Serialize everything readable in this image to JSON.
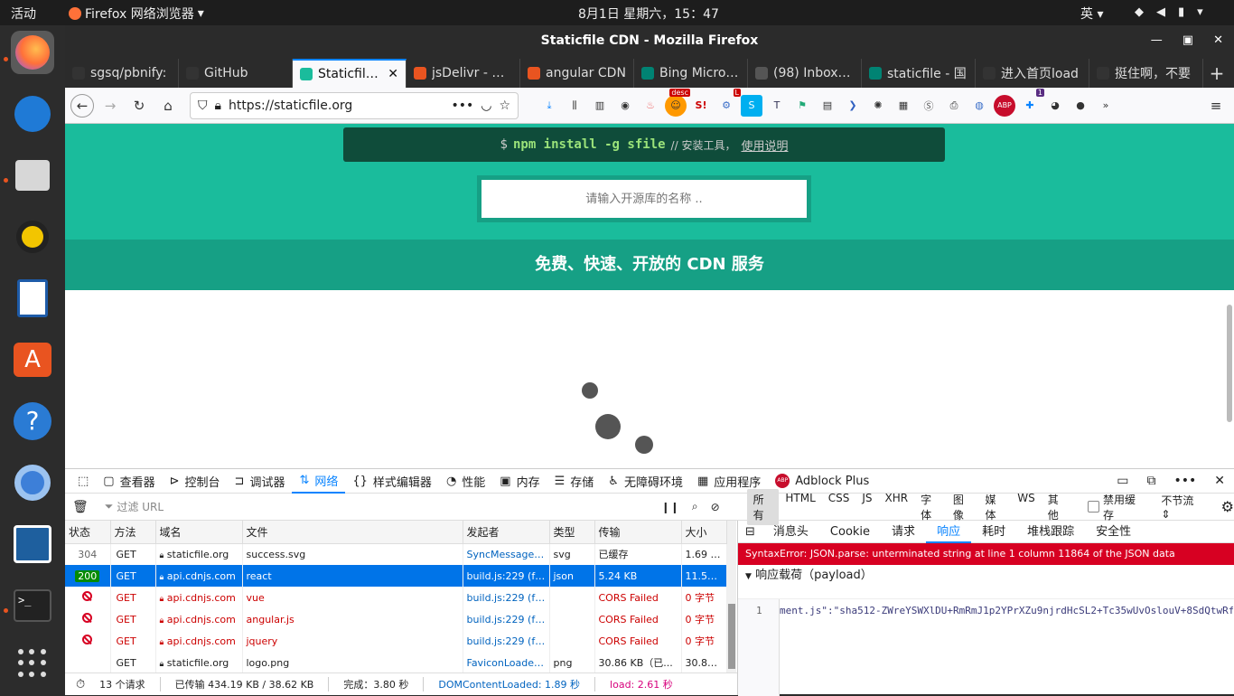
{
  "system": {
    "activities": "活动",
    "app_name": "Firefox 网络浏览器",
    "clock": "8月1日 星期六，15：47",
    "ime": "英"
  },
  "window": {
    "title": "Staticfile CDN - Mozilla Firefox"
  },
  "tabs": [
    {
      "label": "sgsq/pbnify:",
      "color": "#333"
    },
    {
      "label": "GitHub",
      "color": "#333"
    },
    {
      "label": "Staticfile CDN",
      "color": "#1abc9c",
      "active": true
    },
    {
      "label": "jsDelivr - A fr",
      "color": "#e95420"
    },
    {
      "label": "angular CDN",
      "color": "#e95420"
    },
    {
      "label": "Bing Microsoft",
      "color": "#008373"
    },
    {
      "label": "(98) Inbox | s",
      "color": "#555"
    },
    {
      "label": "staticfile - 国",
      "color": "#008373"
    },
    {
      "label": "进入首页load",
      "color": "#333"
    },
    {
      "label": "挺住啊，不要",
      "color": "#333"
    }
  ],
  "navbar": {
    "url": "https://staticfile.org",
    "ext_badge_desc": "desc",
    "ext_badge_l": "L",
    "ext_badge_1": "1"
  },
  "page": {
    "npm_prompt": "$",
    "npm_cmd": "npm install -g sfile",
    "npm_comment": "// 安装工具，",
    "npm_link": "使用说明",
    "search_placeholder": "请输入开源库的名称 ..",
    "banner": "免费、快速、开放的 CDN 服务"
  },
  "devtools": {
    "tabs": [
      "查看器",
      "控制台",
      "调试器",
      "网络",
      "样式编辑器",
      "性能",
      "内存",
      "存储",
      "无障碍环境",
      "应用程序",
      "Adblock Plus"
    ],
    "filter_placeholder": "过滤 URL",
    "type_filters": [
      "所有",
      "HTML",
      "CSS",
      "JS",
      "XHR",
      "字体",
      "图像",
      "媒体",
      "WS",
      "其他"
    ],
    "disable_cache": "禁用缓存",
    "throttle": "不节流",
    "columns": [
      "状态",
      "方法",
      "域名",
      "文件",
      "发起者",
      "类型",
      "传输",
      "大小"
    ],
    "rows": [
      {
        "status": "304",
        "method": "GET",
        "domain": "staticfile.org",
        "file": "success.svg",
        "initiator": "SyncMessage.j...",
        "type": "svg",
        "transfer": "已缓存",
        "size": "1.69 KB",
        "state": "normal"
      },
      {
        "status": "200",
        "method": "GET",
        "domain": "api.cdnjs.com",
        "file": "react",
        "initiator": "build.js:229 (fe...",
        "type": "json",
        "transfer": "5.24 KB",
        "size": "11.58...",
        "state": "selected"
      },
      {
        "status": "",
        "method": "GET",
        "domain": "api.cdnjs.com",
        "file": "vue",
        "initiator": "build.js:229 (fe...",
        "type": "",
        "transfer": "CORS Failed",
        "size": "0 字节",
        "state": "error"
      },
      {
        "status": "",
        "method": "GET",
        "domain": "api.cdnjs.com",
        "file": "angular.js",
        "initiator": "build.js:229 (fe...",
        "type": "",
        "transfer": "CORS Failed",
        "size": "0 字节",
        "state": "error"
      },
      {
        "status": "",
        "method": "GET",
        "domain": "api.cdnjs.com",
        "file": "jquery",
        "initiator": "build.js:229 (fe...",
        "type": "",
        "transfer": "CORS Failed",
        "size": "0 字节",
        "state": "error"
      },
      {
        "status": "",
        "method": "GET",
        "domain": "staticfile.org",
        "file": "logo.png",
        "initiator": "FaviconLoader.j...",
        "type": "png",
        "transfer": "30.86 KB（已...",
        "size": "30.86...",
        "state": "normal"
      }
    ],
    "status": {
      "requests": "13 个请求",
      "transferred": "已传输 434.19 KB / 38.62 KB",
      "finish": "完成：3.80 秒",
      "dcl": "DOMContentLoaded: 1.89 秒",
      "load": "load: 2.61 秒"
    },
    "panel_tabs": [
      "消息头",
      "Cookie",
      "请求",
      "响应",
      "耗时",
      "堆栈跟踪",
      "安全性"
    ],
    "error": "SyntaxError: JSON.parse: unterminated string at line 1 column 11864 of the JSON data",
    "payload_label": "响应载荷（payload）",
    "code_line_no": "1",
    "code_line": "ment.js\":\"sha512-ZWreYSWXlDU+RmRmJ1p2YPrXZu9njrdHcSL2+Tc35wUvOslouV+8SdQtwRf"
  }
}
